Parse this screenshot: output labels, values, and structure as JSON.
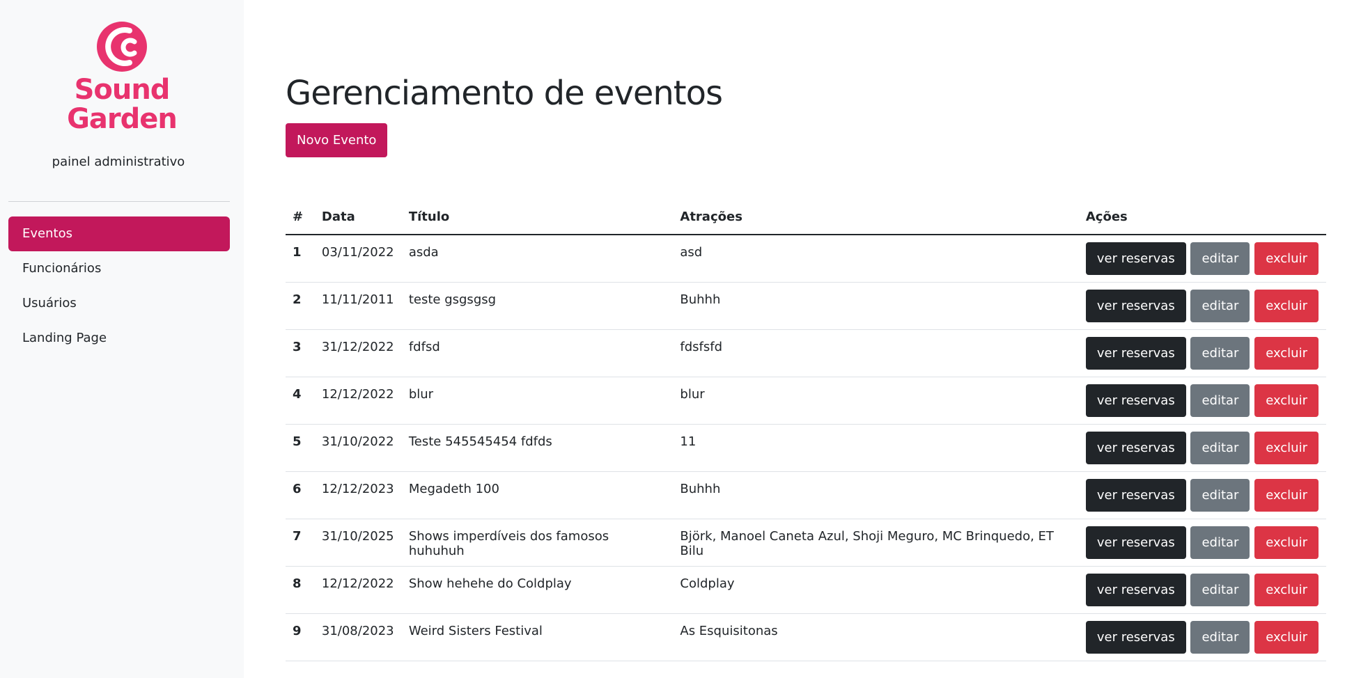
{
  "brand": {
    "name_line1": "Sound",
    "name_line2": "Garden",
    "subtitle": "painel administrativo",
    "color": "#e8336e"
  },
  "colors": {
    "primary": "#c2185b",
    "dark": "#212529",
    "secondary": "#6c757d",
    "danger": "#dc3545"
  },
  "sidebar": {
    "items": [
      {
        "label": "Eventos",
        "active": true
      },
      {
        "label": "Funcionários",
        "active": false
      },
      {
        "label": "Usuários",
        "active": false
      },
      {
        "label": "Landing Page",
        "active": false
      }
    ]
  },
  "main": {
    "title": "Gerenciamento de eventos",
    "new_button": "Novo Evento"
  },
  "table": {
    "headers": {
      "num": "#",
      "date": "Data",
      "title": "Título",
      "attractions": "Atrações",
      "actions": "Ações"
    },
    "action_labels": {
      "reservations": "ver reservas",
      "edit": "editar",
      "delete": "excluir"
    },
    "rows": [
      {
        "num": "1",
        "date": "03/11/2022",
        "title": "asda",
        "attractions": "asd"
      },
      {
        "num": "2",
        "date": "11/11/2011",
        "title": "teste gsgsgsg",
        "attractions": "Buhhh"
      },
      {
        "num": "3",
        "date": "31/12/2022",
        "title": "fdfsd",
        "attractions": "fdsfsfd"
      },
      {
        "num": "4",
        "date": "12/12/2022",
        "title": "blur",
        "attractions": "blur"
      },
      {
        "num": "5",
        "date": "31/10/2022",
        "title": "Teste 545545454 fdfds",
        "attractions": "11"
      },
      {
        "num": "6",
        "date": "12/12/2023",
        "title": "Megadeth 100",
        "attractions": "Buhhh"
      },
      {
        "num": "7",
        "date": "31/10/2025",
        "title": "Shows imperdíveis dos famosos huhuhuh",
        "attractions": "Björk, Manoel Caneta Azul, Shoji Meguro, MC Brinquedo, ET Bilu"
      },
      {
        "num": "8",
        "date": "12/12/2022",
        "title": "Show hehehe do Coldplay",
        "attractions": "Coldplay"
      },
      {
        "num": "9",
        "date": "31/08/2023",
        "title": "Weird Sisters Festival",
        "attractions": "As Esquisitonas"
      }
    ]
  }
}
